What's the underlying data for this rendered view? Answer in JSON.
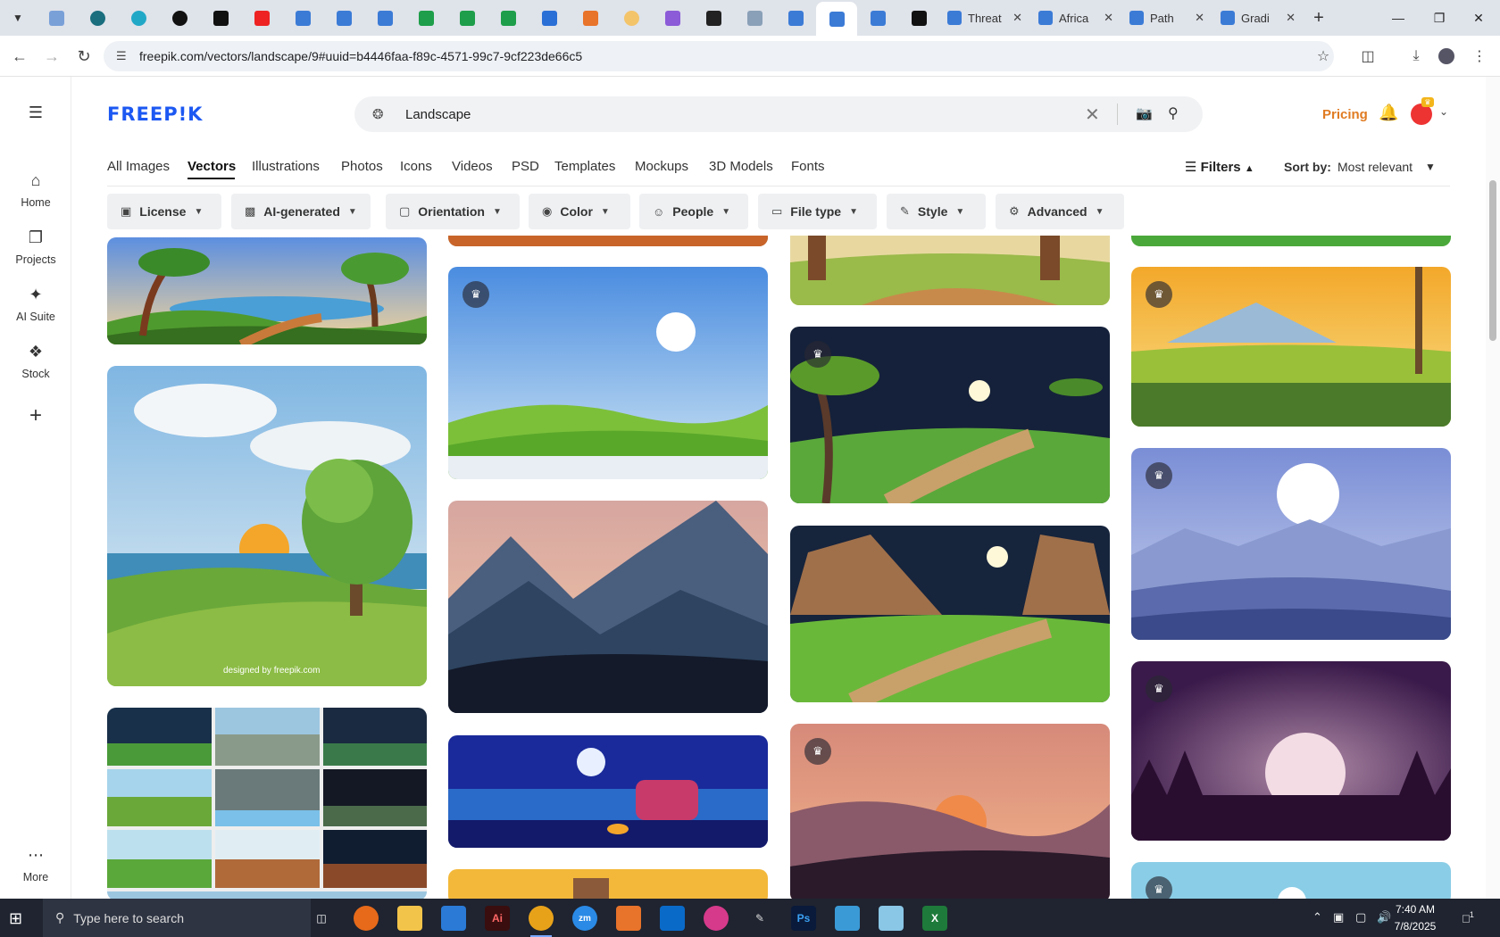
{
  "browser": {
    "tabs": [
      {
        "title": "Threat"
      },
      {
        "title": "Africa"
      },
      {
        "title": "Path"
      },
      {
        "title": "Gradi"
      }
    ],
    "url": "freepik.com/vectors/landscape/9#uuid=b4446faa-f89c-4571-99c7-9cf223de66c5"
  },
  "sidebar": {
    "items": [
      {
        "label": "Home",
        "icon": "home-icon"
      },
      {
        "label": "Projects",
        "icon": "projects-icon"
      },
      {
        "label": "AI Suite",
        "icon": "sparkle-icon"
      },
      {
        "label": "Stock",
        "icon": "stock-icon"
      }
    ],
    "more_label": "More"
  },
  "header": {
    "logo": "FREEP!K",
    "search_value": "Landscape",
    "pricing_label": "Pricing"
  },
  "categories": [
    "All Images",
    "Vectors",
    "Illustrations",
    "Photos",
    "Icons",
    "Videos",
    "PSD",
    "Templates",
    "Mockups",
    "3D Models",
    "Fonts"
  ],
  "active_category": "Vectors",
  "toolbar": {
    "filters_label": "Filters",
    "sort_label": "Sort by:",
    "sort_value": "Most relevant"
  },
  "chips": [
    "License",
    "AI-generated",
    "Orientation",
    "Color",
    "People",
    "File type",
    "Style",
    "Advanced"
  ],
  "gallery": {
    "watermark": "designed by freepik.com"
  },
  "taskbar": {
    "search_placeholder": "Type here to search",
    "time": "7:40 AM",
    "date": "7/8/2025",
    "notification_count": "1"
  },
  "colors": {
    "brand": "#1c58f2",
    "pricing": "#e07b22"
  }
}
